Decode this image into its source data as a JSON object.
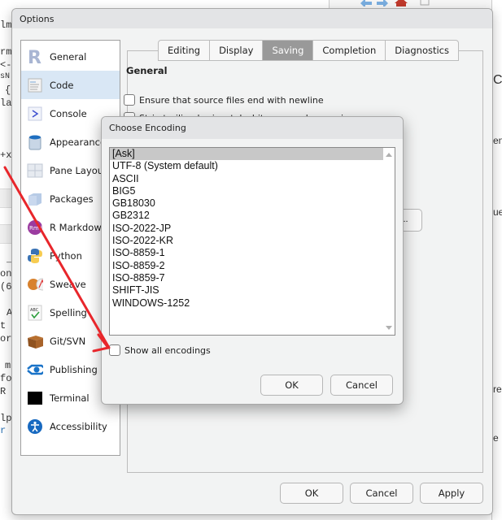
{
  "background": {
    "left_code_fragments": [
      "lm",
      "rm",
      "<-",
      "sN",
      "{",
      "la",
      "+x",
      "_",
      "on",
      "(6",
      "A",
      "t",
      "or",
      "m",
      "fo",
      "R",
      "lp",
      "r"
    ],
    "right_text_fragments": [
      "C",
      "en",
      "ue",
      "re",
      "e"
    ]
  },
  "options": {
    "title": "Options",
    "sidebar": [
      {
        "label": "General",
        "icon": "r-logo-icon"
      },
      {
        "label": "Code",
        "icon": "code-document-icon",
        "active": true
      },
      {
        "label": "Console",
        "icon": "console-prompt-icon"
      },
      {
        "label": "Appearance",
        "icon": "paint-bucket-icon"
      },
      {
        "label": "Pane Layout",
        "icon": "pane-layout-icon"
      },
      {
        "label": "Packages",
        "icon": "package-box-icon"
      },
      {
        "label": "R Markdown",
        "icon": "r-markdown-icon"
      },
      {
        "label": "Python",
        "icon": "python-logo-icon"
      },
      {
        "label": "Sweave",
        "icon": "sweave-pdf-icon"
      },
      {
        "label": "Spelling",
        "icon": "spellcheck-icon"
      },
      {
        "label": "Git/SVN",
        "icon": "git-box-icon"
      },
      {
        "label": "Publishing",
        "icon": "publishing-icon"
      },
      {
        "label": "Terminal",
        "icon": "terminal-icon"
      },
      {
        "label": "Accessibility",
        "icon": "accessibility-icon"
      }
    ],
    "tabs": [
      {
        "label": "Editing"
      },
      {
        "label": "Display"
      },
      {
        "label": "Saving",
        "active": true
      },
      {
        "label": "Completion"
      },
      {
        "label": "Diagnostics"
      }
    ],
    "section_title": "General",
    "options_list": [
      {
        "label": "Ensure that source files end with newline",
        "checked": false
      },
      {
        "label": "Strip trailing horizontal whitespace when saving",
        "checked": false
      }
    ],
    "browse_label": "...",
    "buttons": {
      "ok": "OK",
      "cancel": "Cancel",
      "apply": "Apply"
    }
  },
  "encoding_dialog": {
    "title": "Choose Encoding",
    "encodings": [
      "[Ask]",
      "UTF-8 (System default)",
      "ASCII",
      "BIG5",
      "GB18030",
      "GB2312",
      "ISO-2022-JP",
      "ISO-2022-KR",
      "ISO-8859-1",
      "ISO-8859-2",
      "ISO-8859-7",
      "SHIFT-JIS",
      "WINDOWS-1252"
    ],
    "selected": "[Ask]",
    "show_all_label": "Show all encodings",
    "show_all_checked": false,
    "buttons": {
      "ok": "OK",
      "cancel": "Cancel"
    }
  },
  "annotation": {
    "arrow_color": "#e8262b",
    "points_to": "Show all encodings"
  }
}
